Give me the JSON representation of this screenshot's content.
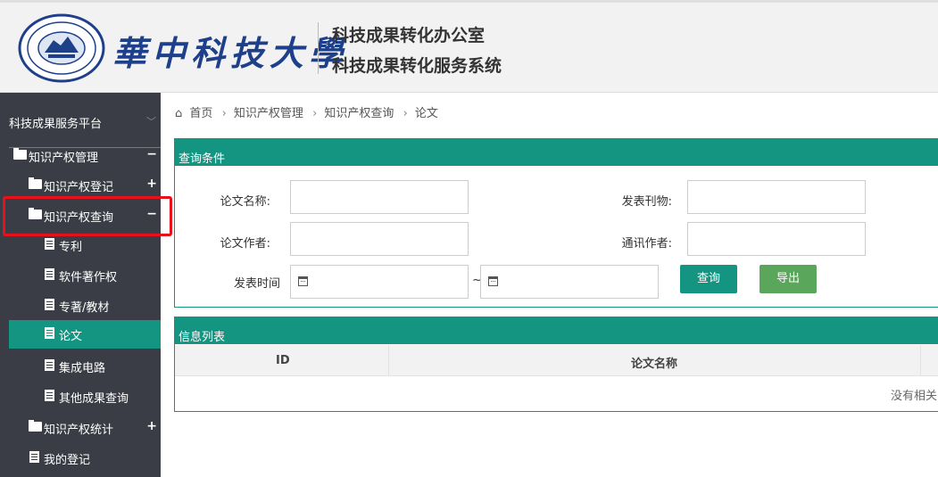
{
  "header": {
    "university_name": "華中科技大學",
    "system_line1": "科技成果转化办公室",
    "system_line2": "科技成果转化服务系统"
  },
  "sidebar": {
    "top_label": "科技成果服务平台",
    "items": [
      {
        "label": "知识产权管理",
        "sign": "−",
        "icon": "folder-icon"
      },
      {
        "label": "知识产权登记",
        "sign": "+",
        "icon": "folder-icon"
      },
      {
        "label": "知识产权查询",
        "sign": "−",
        "icon": "folder-icon"
      },
      {
        "label": "专利",
        "icon": "document-icon"
      },
      {
        "label": "软件著作权",
        "icon": "document-icon"
      },
      {
        "label": "专著/教材",
        "icon": "document-icon"
      },
      {
        "label": "论文",
        "icon": "document-icon",
        "active": true
      },
      {
        "label": "集成电路",
        "icon": "document-icon"
      },
      {
        "label": "其他成果查询",
        "icon": "document-icon"
      },
      {
        "label": "知识产权统计",
        "sign": "+",
        "icon": "folder-icon"
      },
      {
        "label": "我的登记",
        "icon": "document-icon"
      }
    ],
    "accent_color": "#149582"
  },
  "breadcrumb": [
    "首页",
    "知识产权管理",
    "知识产权查询",
    "论文"
  ],
  "query_panel": {
    "title": "查询条件",
    "paper_name_label": "论文名称:",
    "journal_label": "发表刊物:",
    "author_label": "论文作者:",
    "corresponding_author_label": "通讯作者:",
    "publish_time_label": "发表时间",
    "range_separator": "~",
    "query_button": "查询",
    "export_button": "导出"
  },
  "list_panel": {
    "title": "信息列表",
    "columns": [
      "ID",
      "论文名称"
    ],
    "empty_text": "没有相关"
  }
}
